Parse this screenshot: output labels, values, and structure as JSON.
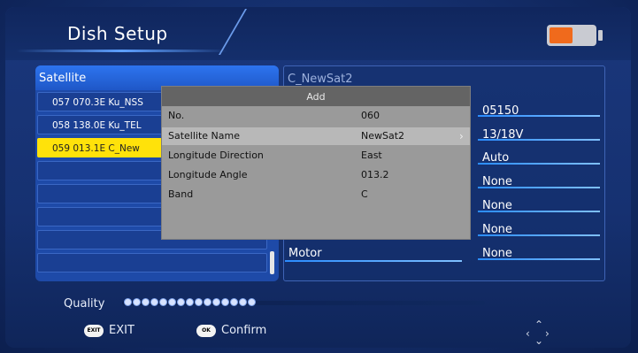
{
  "header": {
    "title": "Dish Setup"
  },
  "battery": {
    "icon": "battery-icon",
    "level_color": "#f06a1c"
  },
  "satellite_list": {
    "heading": "Satellite",
    "items": [
      {
        "label": "057 070.3E Ku_NSS",
        "selected": false
      },
      {
        "label": "058 138.0E Ku_TEL",
        "selected": false
      },
      {
        "label": "059 013.1E C_New",
        "selected": true
      },
      {
        "label": "",
        "selected": false
      },
      {
        "label": "",
        "selected": false
      },
      {
        "label": "",
        "selected": false
      },
      {
        "label": "",
        "selected": false
      },
      {
        "label": "",
        "selected": false
      }
    ]
  },
  "details": {
    "title": "C_NewSat2",
    "values": [
      "05150",
      "13/18V",
      "Auto",
      "None",
      "None",
      "None"
    ],
    "motor_label": "Motor",
    "motor_value": "None"
  },
  "dialog": {
    "title": "Add",
    "fields": [
      {
        "label": "No.",
        "value": "060"
      },
      {
        "label": "Satellite Name",
        "value": "NewSat2"
      },
      {
        "label": "Longitude Direction",
        "value": "East"
      },
      {
        "label": "Longitude Angle",
        "value": "013.2"
      },
      {
        "label": "Band",
        "value": "C"
      }
    ]
  },
  "quality": {
    "label": "Quality",
    "level_fraction": 0.38
  },
  "footer": {
    "exit_icon_text": "EXIT",
    "exit_label": "EXIT",
    "ok_icon_text": "OK",
    "confirm_label": "Confirm"
  }
}
